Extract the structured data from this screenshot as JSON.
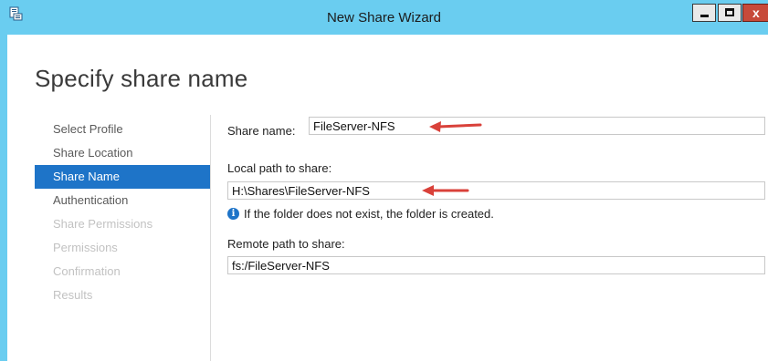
{
  "window": {
    "title": "New Share Wizard",
    "close_glyph": "x"
  },
  "page": {
    "title": "Specify share name"
  },
  "steps": [
    {
      "label": "Select Profile",
      "state": "done"
    },
    {
      "label": "Share Location",
      "state": "done"
    },
    {
      "label": "Share Name",
      "state": "active"
    },
    {
      "label": "Authentication",
      "state": "pending"
    },
    {
      "label": "Share Permissions",
      "state": "disabled"
    },
    {
      "label": "Permissions",
      "state": "disabled"
    },
    {
      "label": "Confirmation",
      "state": "disabled"
    },
    {
      "label": "Results",
      "state": "disabled"
    }
  ],
  "form": {
    "share_name_label": "Share name:",
    "share_name_value": "FileServer-NFS",
    "local_path_label": "Local path to share:",
    "local_path_value": "H:\\Shares\\FileServer-NFS",
    "info_text": "If the folder does not exist, the folder is created.",
    "remote_path_label": "Remote path to share:",
    "remote_path_value": "fs:/FileServer-NFS"
  },
  "colors": {
    "titlebar": "#6acdf0",
    "active_step": "#1e74c8",
    "annotation_arrow": "#d9413a"
  },
  "icons": {
    "app": "share-wizard-icon",
    "info": "info-icon",
    "annotation": "red-arrow-icon"
  }
}
